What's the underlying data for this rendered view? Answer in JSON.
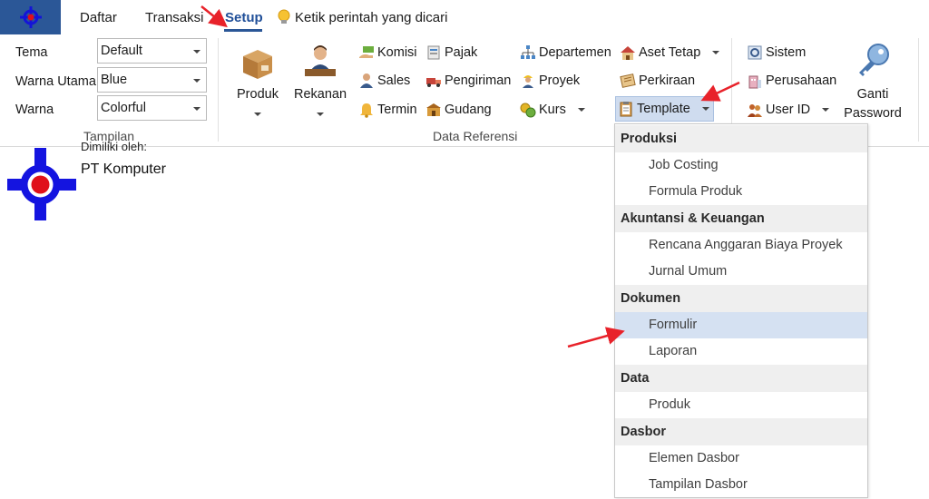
{
  "menubar": {
    "tabs": [
      {
        "label": "Daftar"
      },
      {
        "label": "Transaksi"
      },
      {
        "label": "Setup"
      }
    ],
    "tell_me": "Ketik perintah yang dicari"
  },
  "ribbon": {
    "tampilan": {
      "label": "Tampilan",
      "fields": [
        {
          "label": "Tema",
          "value": "Default"
        },
        {
          "label": "Warna Utama",
          "value": "Blue"
        },
        {
          "label": "Warna",
          "value": "Colorful"
        }
      ]
    },
    "data_referensi": {
      "label": "Data Referensi",
      "produk": "Produk",
      "rekanan": "Rekanan",
      "komisi": "Komisi",
      "pajak": "Pajak",
      "departemen": "Departemen",
      "aset_tetap": "Aset Tetap",
      "sales": "Sales",
      "pengiriman": "Pengiriman",
      "proyek": "Proyek",
      "perkiraan": "Perkiraan",
      "termin": "Termin",
      "gudang": "Gudang",
      "kurs": "Kurs",
      "template": "Template"
    },
    "sistem": {
      "sistem": "Sistem",
      "perusahaan": "Perusahaan",
      "user_id": "User ID",
      "ganti_password_1": "Ganti",
      "ganti_password_2": "Password"
    }
  },
  "content": {
    "owner_label": "Dimiliki oleh:",
    "company": "PT Komputer"
  },
  "template_menu": {
    "sections": [
      {
        "title": "Produksi",
        "items": [
          "Job Costing",
          "Formula Produk"
        ]
      },
      {
        "title": "Akuntansi & Keuangan",
        "items": [
          "Rencana Anggaran Biaya Proyek",
          "Jurnal Umum"
        ]
      },
      {
        "title": "Dokumen",
        "items": [
          "Formulir",
          "Laporan"
        ]
      },
      {
        "title": "Data",
        "items": [
          "Produk"
        ]
      },
      {
        "title": "Dasbor",
        "items": [
          "Elemen Dasbor",
          "Tampilan Dasbor"
        ]
      }
    ],
    "highlighted": "Formulir"
  },
  "colors": {
    "accent": "#2b5797",
    "annotation_arrow": "#e8222a",
    "menu_highlight": "#d5e1f2"
  }
}
